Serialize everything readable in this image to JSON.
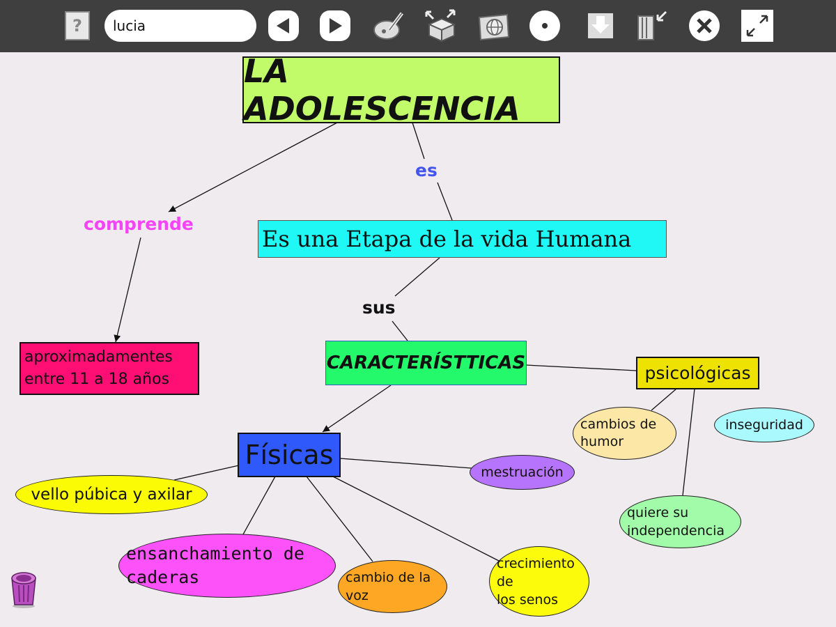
{
  "toolbar": {
    "name_value": "lucia",
    "buttons": [
      {
        "id": "help",
        "icon": "help-icon"
      },
      {
        "id": "back",
        "icon": "arrow-left-icon"
      },
      {
        "id": "forward",
        "icon": "arrow-right-icon"
      },
      {
        "id": "paint",
        "icon": "paint-palette-icon"
      },
      {
        "id": "export",
        "icon": "box-export-icon"
      },
      {
        "id": "browse",
        "icon": "globe-map-icon"
      },
      {
        "id": "record",
        "icon": "record-dot-icon"
      },
      {
        "id": "download",
        "icon": "download-icon"
      },
      {
        "id": "import",
        "icon": "import-book-icon"
      },
      {
        "id": "close",
        "icon": "close-icon"
      },
      {
        "id": "fullscreen",
        "icon": "fullscreen-icon"
      }
    ]
  },
  "map": {
    "title": "LA ADOLESCENCIA",
    "link_es": "es",
    "link_comprende": "comprende",
    "link_sus": "sus",
    "etapa": "Es una Etapa de la vida Humana ",
    "edad": "aproximadamentes\nentre 11 a 18  años",
    "caracteristicas": "CARACTERÍSTTICAS",
    "psicologicas": "psicológicas",
    "fisicas": "Físicas",
    "cambios_humor": "cambios de\nhumor",
    "inseguridad": "inseguridad",
    "independencia": "quiere su\nindependencia",
    "mestruacion": "mestruación",
    "vello": "vello púbica y axilar",
    "caderas": "ensanchamiento de\ncaderas",
    "voz": "cambio de la\nvoz",
    "senos": "crecimiento\nde\nlos senos"
  },
  "colors": {
    "title_bg": "#c1fb6a",
    "etapa_bg": "#1ff8f4",
    "edad_bg": "#ff0f74",
    "caracteristicas_bg": "#23f96b",
    "psicologicas_bg": "#ede201",
    "fisicas_bg": "#2f59fa",
    "comprende_text": "#f444f5",
    "es_text": "#4455ee"
  },
  "trash": {
    "icon": "trash-icon"
  }
}
